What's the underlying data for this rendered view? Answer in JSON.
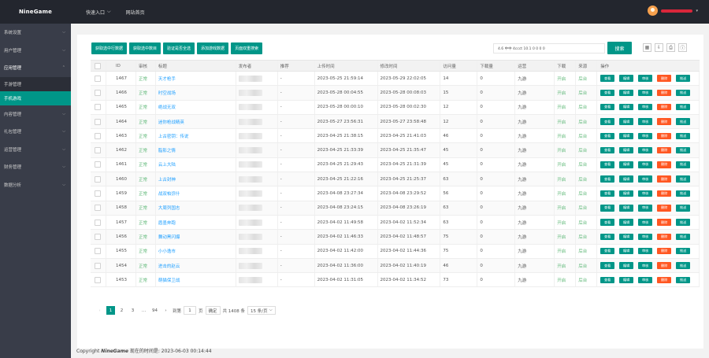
{
  "app": {
    "logo": "NineGame"
  },
  "topnav": {
    "quick_entry": "快速入口",
    "website_home": "网站首页"
  },
  "sidebar": {
    "items": [
      {
        "label": "系统设置"
      },
      {
        "label": "用户管理"
      },
      {
        "label": "应用管理",
        "open": true
      },
      {
        "label": "内容管理"
      },
      {
        "label": "礼包管理"
      },
      {
        "label": "运营管理"
      },
      {
        "label": "财务管理"
      },
      {
        "label": "数据分析"
      }
    ],
    "sub": [
      {
        "label": "手游管理"
      },
      {
        "label": "手机游戏",
        "active": true
      }
    ]
  },
  "toolbar": {
    "buttons": [
      "获取选中行数据",
      "获取选中数目",
      "验证是否全选",
      "添加游戏数据",
      "页面双重搜索"
    ],
    "search_text": "4.6 中中 4ccct 10.1 0 0 0 0",
    "search_btn": "搜索"
  },
  "table": {
    "headers": {
      "id": "ID",
      "status": "审核",
      "title": "标题",
      "publisher": "发布者",
      "recommend": "推荐",
      "upload": "上传时间",
      "modified": "修改时间",
      "visits": "访问量",
      "downloads": "下载量",
      "operator": "运营",
      "download": "下载",
      "source": "来源",
      "actions": "操作"
    },
    "action_labels": {
      "view": "查看",
      "edit": "编辑",
      "review": "审核",
      "delete": "删除",
      "push": "推送"
    },
    "rows": [
      {
        "id": "1467",
        "status": "正常",
        "title": "天才枪手",
        "rec": "-",
        "up": "2023-05-25 21:59:14",
        "mod": "2023-05-29 22:02:05",
        "visits": "14",
        "dl": "0",
        "op": "九游",
        "dn": "开启",
        "src": "后台"
      },
      {
        "id": "1466",
        "status": "正常",
        "title": "时空战场",
        "rec": "-",
        "up": "2023-05-28 00:04:55",
        "mod": "2023-05-28 00:08:03",
        "visits": "15",
        "dl": "0",
        "op": "九游",
        "dn": "开启",
        "src": "后台"
      },
      {
        "id": "1465",
        "status": "正常",
        "title": "绝战无双",
        "rec": "-",
        "up": "2023-05-28 00:00:10",
        "mod": "2023-05-28 00:02:30",
        "visits": "12",
        "dl": "0",
        "op": "九游",
        "dn": "开启",
        "src": "后台"
      },
      {
        "id": "1464",
        "status": "正常",
        "title": "迷你枪战精英",
        "rec": "-",
        "up": "2023-05-27 23:56:31",
        "mod": "2023-05-27 23:58:48",
        "visits": "12",
        "dl": "0",
        "op": "九游",
        "dn": "开启",
        "src": "后台"
      },
      {
        "id": "1463",
        "status": "正常",
        "title": "上古密钥：传说",
        "rec": "-",
        "up": "2023-04-25 21:38:15",
        "mod": "2023-04-25 21:41:03",
        "visits": "46",
        "dl": "0",
        "op": "九游",
        "dn": "开启",
        "src": "后台"
      },
      {
        "id": "1462",
        "status": "正常",
        "title": "脂影之情",
        "rec": "-",
        "up": "2023-04-25 21:33:39",
        "mod": "2023-04-25 21:35:47",
        "visits": "45",
        "dl": "0",
        "op": "九游",
        "dn": "开启",
        "src": "后台"
      },
      {
        "id": "1461",
        "status": "正常",
        "title": "云上大陆",
        "rec": "-",
        "up": "2023-04-25 21:29:43",
        "mod": "2023-04-25 21:31:39",
        "visits": "45",
        "dl": "0",
        "op": "九游",
        "dn": "开启",
        "src": "后台"
      },
      {
        "id": "1460",
        "status": "正常",
        "title": "上古封神",
        "rec": "-",
        "up": "2023-04-25 21:22:16",
        "mod": "2023-04-25 21:25:37",
        "visits": "63",
        "dl": "0",
        "op": "九游",
        "dn": "开启",
        "src": "后台"
      },
      {
        "id": "1459",
        "status": "正常",
        "title": "战双帕弥什",
        "rec": "-",
        "up": "2023-04-08 23:27:34",
        "mod": "2023-04-08 23:29:52",
        "visits": "56",
        "dl": "0",
        "op": "九游",
        "dn": "开启",
        "src": "后台"
      },
      {
        "id": "1458",
        "status": "正常",
        "title": "大周列国志",
        "rec": "-",
        "up": "2023-04-08 23:24:15",
        "mod": "2023-04-08 23:26:19",
        "visits": "63",
        "dl": "0",
        "op": "九游",
        "dn": "开启",
        "src": "后台"
      },
      {
        "id": "1457",
        "status": "正常",
        "title": "盾墨奔跑",
        "rec": "-",
        "up": "2023-04-02 11:49:58",
        "mod": "2023-04-02 11:52:34",
        "visits": "63",
        "dl": "0",
        "op": "九游",
        "dn": "开启",
        "src": "后台"
      },
      {
        "id": "1456",
        "status": "正常",
        "title": "舞动黑闪爆",
        "rec": "-",
        "up": "2023-04-02 11:46:33",
        "mod": "2023-04-02 11:48:57",
        "visits": "75",
        "dl": "0",
        "op": "九游",
        "dn": "开启",
        "src": "后台"
      },
      {
        "id": "1455",
        "status": "正常",
        "title": "小小逸市",
        "rec": "-",
        "up": "2023-04-02 11:42:00",
        "mod": "2023-04-02 11:44:36",
        "visits": "75",
        "dl": "0",
        "op": "九游",
        "dn": "开启",
        "src": "后台"
      },
      {
        "id": "1454",
        "status": "正常",
        "title": "进击的赵云",
        "rec": "-",
        "up": "2023-04-02 11:36:00",
        "mod": "2023-04-02 11:40:19",
        "visits": "46",
        "dl": "0",
        "op": "九游",
        "dn": "开启",
        "src": "后台"
      },
      {
        "id": "1453",
        "status": "正常",
        "title": "萌猫保卫战",
        "rec": "-",
        "up": "2023-04-02 11:31:05",
        "mod": "2023-04-02 11:34:52",
        "visits": "73",
        "dl": "0",
        "op": "九游",
        "dn": "开启",
        "src": "后台"
      }
    ]
  },
  "pager": {
    "prev": "‹",
    "p1": "1",
    "p2": "2",
    "p3": "3",
    "ellipsis": "…",
    "last": "94",
    "next": "›",
    "goto_label": "到第",
    "goto_value": "1",
    "page_unit": "页",
    "confirm": "确定",
    "total": "共 1408 条",
    "page_size": "15 条/页"
  },
  "footer": {
    "prefix": "Copyright ",
    "brand": "NineGame",
    "text": " 现在的时间是: 2023-06-03 00:14:44"
  }
}
